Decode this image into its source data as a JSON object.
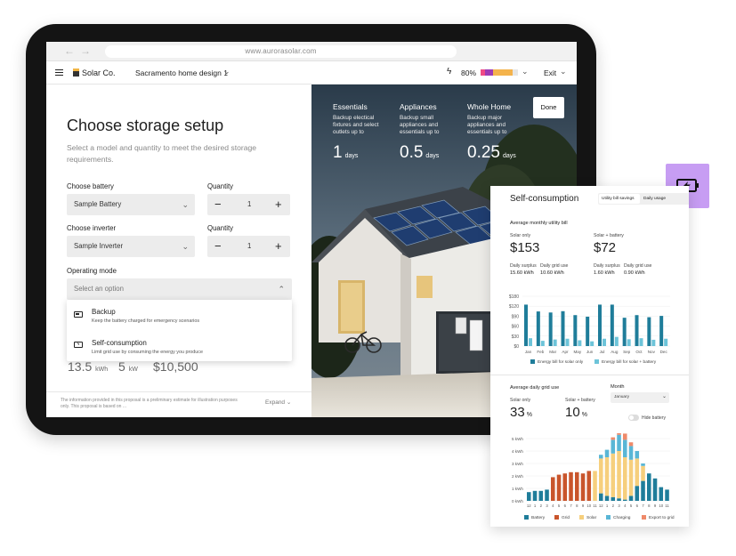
{
  "browser": {
    "url": "www.aurorasolar.com",
    "back": "←",
    "forward": "→"
  },
  "app": {
    "logo": "Solar Co.",
    "project": "Sacramento home design 1",
    "battery_percent": "80%",
    "battery_colors": [
      "#ef4a86",
      "#9d3ab6",
      "#f4b34c",
      "#f2c35a"
    ],
    "exit": "Exit"
  },
  "storage": {
    "title": "Choose storage setup",
    "subtitle": "Select a model and quantity to meet the desired storage requirements.",
    "battery_label": "Choose battery",
    "battery_value": "Sample Battery",
    "inverter_label": "Choose inverter",
    "inverter_value": "Sample Inverter",
    "quantity_label": "Quantity",
    "battery_qty": "1",
    "inverter_qty": "1",
    "minus": "−",
    "plus": "+",
    "mode_label": "Operating mode",
    "mode_placeholder": "Select an option",
    "options": [
      {
        "title": "Backup",
        "desc": "Keep the battery charged for emergency scenarios",
        "icon": "battery-icon"
      },
      {
        "title": "Self-consumption",
        "desc": "Limit grid use by consuming the energy you produce",
        "icon": "battery-charging-icon"
      }
    ],
    "summary": [
      {
        "value": "13.5",
        "unit": "kWh"
      },
      {
        "value": "5",
        "unit": "kW"
      },
      {
        "value": "$10,500",
        "unit": ""
      }
    ],
    "disclaimer": "The information provided in this proposal is a preliminary estimate for illustration purposes only. This proposal is based on ...",
    "expand": "Expand"
  },
  "tiers": [
    {
      "title": "Essentials",
      "desc": "Backup electical fixtures and select outlets up to",
      "value": "1",
      "unit": "days"
    },
    {
      "title": "Appliances",
      "desc": "Backup small appliances and essentials up to",
      "value": "0.5",
      "unit": "days"
    },
    {
      "title": "Whole Home",
      "desc": "Backup major appliances and essentials up to",
      "value": "0.25",
      "unit": "days"
    }
  ],
  "done": "Done",
  "accent_color": "#c79df3",
  "selfcon": {
    "title": "Self-consumption",
    "tabs": [
      "Utility bill savings",
      "Daily usage"
    ],
    "bill_title": "Average monthly utility bill",
    "solar_only_label": "Solar only",
    "solar_battery_label": "Solar + battery",
    "solar_only_value": "$153",
    "solar_battery_value": "$72",
    "stats": [
      {
        "label": "Daily surplus",
        "value": "15.60",
        "unit": "kWh"
      },
      {
        "label": "Daily grid use",
        "value": "10.60",
        "unit": "kWh"
      },
      {
        "label": "Daily surplus",
        "value": "1.60",
        "unit": "kWh"
      },
      {
        "label": "Daily grid use",
        "value": "0.90",
        "unit": "kWh"
      }
    ],
    "grid_title": "Average daily grid use",
    "month_label": "Month",
    "month_value": "January",
    "grid_solar_only": "33",
    "grid_solar_battery": "10",
    "percent": "%",
    "hide_battery": "Hide battery"
  },
  "chart_data": [
    {
      "type": "bar",
      "title": "Average monthly utility bill",
      "categories": [
        "Jan",
        "Feb",
        "Mar",
        "Apr",
        "May",
        "Jun",
        "Jul",
        "Aug",
        "Sep",
        "Oct",
        "Nov",
        "Dec"
      ],
      "yticks": [
        "$180",
        "$120",
        "$90",
        "$60",
        "$30",
        "$0"
      ],
      "ylim": [
        0,
        190
      ],
      "series": [
        {
          "name": "Energy bill for solar only",
          "color": "#1f7d9a",
          "values": [
            158,
            132,
            128,
            133,
            118,
            112,
            158,
            158,
            108,
            118,
            110,
            115
          ]
        },
        {
          "name": "Energy bill for solar + battery",
          "color": "#6dc4d9",
          "values": [
            30,
            20,
            25,
            28,
            22,
            18,
            28,
            35,
            26,
            30,
            24,
            28
          ]
        }
      ],
      "legend": "bottom"
    },
    {
      "type": "bar",
      "title": "Average daily grid use",
      "categories": [
        "12",
        "1",
        "2",
        "3",
        "4",
        "5",
        "6",
        "7",
        "8",
        "9",
        "10",
        "11",
        "12",
        "1",
        "2",
        "3",
        "4",
        "5",
        "6",
        "7",
        "8",
        "9",
        "10",
        "11"
      ],
      "yticks": [
        "5 kWh",
        "4 kWh",
        "3 kWh",
        "2 kWh",
        "1 kWh",
        "0 kWh"
      ],
      "ylim": [
        0,
        5
      ],
      "stacked": true,
      "series": [
        {
          "name": "Battery",
          "color": "#1f7d9a",
          "values": [
            0.7,
            0.8,
            0.8,
            0.9,
            0,
            0,
            0,
            0,
            0,
            0,
            0,
            0,
            0.6,
            0.4,
            0.3,
            0.2,
            0.1,
            0.4,
            1.2,
            1.6,
            2.2,
            1.8,
            1.1,
            0.9
          ]
        },
        {
          "name": "Grid",
          "color": "#c9552c",
          "values": [
            0,
            0,
            0,
            0,
            1.9,
            2.1,
            2.2,
            2.3,
            2.3,
            2.2,
            2.4,
            0,
            0,
            0,
            0,
            0,
            0,
            0,
            0,
            0,
            0,
            0,
            0,
            0
          ]
        },
        {
          "name": "Solar",
          "color": "#f6cf7d",
          "values": [
            0,
            0,
            0,
            0,
            0,
            0,
            0,
            0,
            0,
            0,
            0,
            2.4,
            2.8,
            3.1,
            3.5,
            3.8,
            3.4,
            2.9,
            2.2,
            1.2,
            0,
            0,
            0,
            0
          ]
        },
        {
          "name": "Charging",
          "color": "#59b6d6",
          "values": [
            0,
            0,
            0,
            0,
            0,
            0,
            0,
            0,
            0,
            0,
            0,
            0,
            0.3,
            0.6,
            1.1,
            1.3,
            1.4,
            1.1,
            0.6,
            0.2,
            0,
            0,
            0,
            0
          ]
        },
        {
          "name": "Export to grid",
          "color": "#ef8a6a",
          "values": [
            0,
            0,
            0,
            0,
            0,
            0,
            0,
            0,
            0,
            0,
            0,
            0,
            0,
            0,
            0.2,
            0.4,
            0.5,
            0.3,
            0,
            0,
            0,
            0,
            0,
            0
          ]
        }
      ],
      "legend": "bottom"
    }
  ]
}
